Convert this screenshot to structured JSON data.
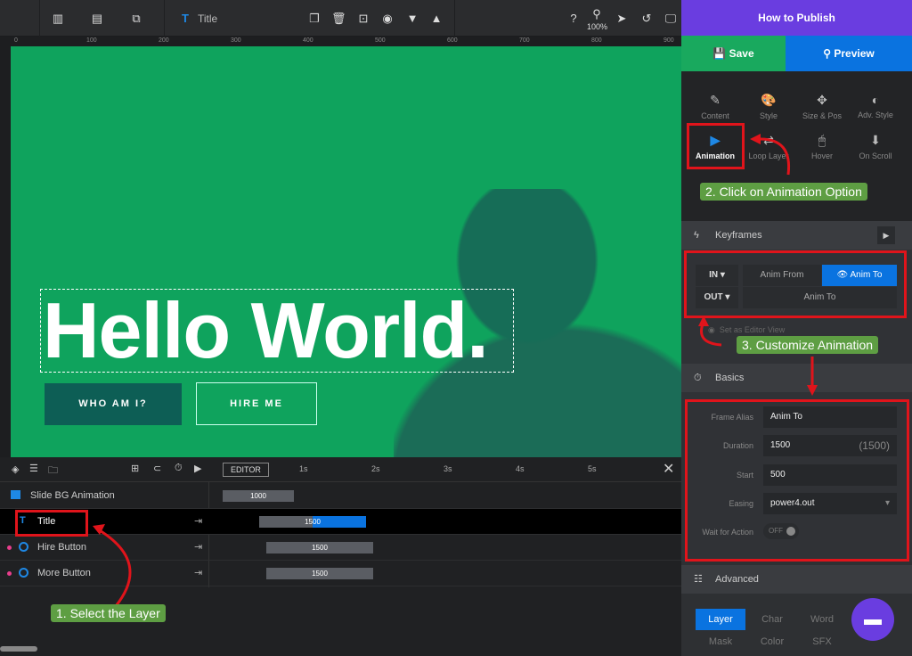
{
  "toolbar": {
    "layer_name": "Title",
    "zoom": "100%"
  },
  "ruler": {
    "ticks": [
      "0",
      "100",
      "200",
      "300",
      "400",
      "500",
      "600",
      "700",
      "800",
      "900"
    ]
  },
  "canvas": {
    "heading": "Hello World.",
    "button1": "WHO AM I?",
    "button2": "HIRE ME",
    "bg_color": "#0fa35d"
  },
  "timeline": {
    "editor_label": "EDITOR",
    "time_ticks": [
      "1s",
      "2s",
      "3s",
      "4s",
      "5s"
    ],
    "layers": [
      {
        "name": "Slide BG Animation",
        "duration": "1000"
      },
      {
        "name": "Title",
        "duration": "1500"
      },
      {
        "name": "Hire Button",
        "duration": "1500"
      },
      {
        "name": "More Button",
        "duration": "1500"
      }
    ]
  },
  "panel": {
    "title": "How to Publish",
    "save": "Save",
    "preview": "Preview",
    "tabs": [
      "Content",
      "Style",
      "Size & Pos",
      "Adv. Style",
      "Animation",
      "Loop Layer",
      "Hover",
      "On Scroll"
    ],
    "keyframes": "Keyframes",
    "in": "IN",
    "out": "OUT",
    "anim_from": "Anim From",
    "anim_to": "Anim To",
    "out_anim_to": "Anim To",
    "editor_view": "Set as Editor View",
    "basics": "Basics",
    "fields": {
      "frame_alias_label": "Frame Alias",
      "frame_alias": "Anim To",
      "duration_label": "Duration",
      "duration": "1500",
      "duration_hint": "(1500)",
      "start_label": "Start",
      "start": "500",
      "easing_label": "Easing",
      "easing": "power4.out",
      "wait_label": "Wait for Action",
      "wait": "OFF"
    },
    "advanced": "Advanced",
    "split": [
      "Layer",
      "Char",
      "Word",
      "Mask",
      "Color",
      "SFX"
    ]
  },
  "annotations": {
    "step1": "1. Select the Layer",
    "step2": "2. Click on Animation Option",
    "step3": "3. Customize Animation"
  },
  "colors": {
    "accent": "#0a73e0",
    "save": "#19a95e",
    "header": "#6a3de0",
    "annotation": "#e0141b"
  }
}
